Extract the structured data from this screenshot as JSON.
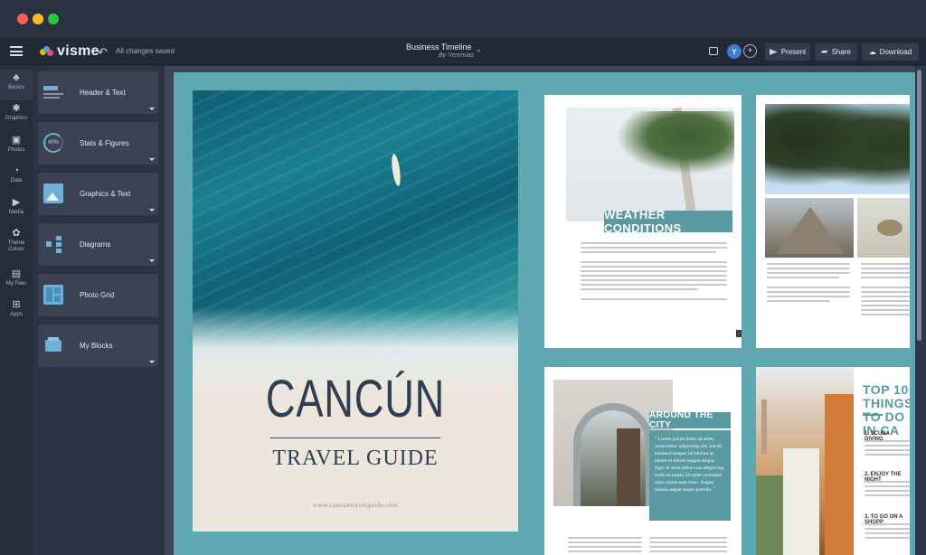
{
  "app": {
    "logo_text": "visme",
    "save_status": "All changes saved",
    "document_title": "Business Timeline",
    "document_author": "By Yeremias",
    "user_initial": "Y",
    "present_label": "Present",
    "share_label": "Share",
    "download_label": "Download"
  },
  "rail": [
    {
      "label": "Basics",
      "icon": "basics-icon"
    },
    {
      "label": "Graphics",
      "icon": "graphics-icon"
    },
    {
      "label": "Photos",
      "icon": "photos-icon"
    },
    {
      "label": "Data",
      "icon": "data-icon"
    },
    {
      "label": "Media",
      "icon": "media-icon"
    },
    {
      "label": "Theme Colors",
      "icon": "palette-icon"
    },
    {
      "label": "My Files",
      "icon": "files-icon"
    },
    {
      "label": "Apps",
      "icon": "apps-icon"
    }
  ],
  "panel": [
    {
      "label": "Header & Text"
    },
    {
      "label": "Stats & Figures",
      "badge": "40%"
    },
    {
      "label": "Graphics & Text"
    },
    {
      "label": "Diagrams"
    },
    {
      "label": "Photo Grid"
    },
    {
      "label": "My Blocks"
    }
  ],
  "cover": {
    "title": "CANCÚN",
    "subtitle": "TRAVEL GUIDE",
    "url": "www.cancuntravelguide.com"
  },
  "pages": {
    "weather_heading": "WEATHER CONDITIONS",
    "city_heading": "AROUND THE CITY",
    "city_quote": "\" Lorem ipsum dolor sit amet, consectetur adipiscing elit, sed do eiusmod tempor incididunt ut labore et dolore magna aliqua. Eget sit amet tellus cras adipiscing enim eu turpis. Ut amet venenatis urna cursus eget nunc. Augue mauris augue neque gravida. \"",
    "top10_heading": "TOP 10 THINGS TO DO IN CA",
    "top10_items": [
      "1. SCUBA DIVING",
      "2. ENJOY THE NIGHT",
      "3. TO GO ON A SHOPP"
    ]
  },
  "colors": {
    "accent": "#5a9aa2",
    "stage": "#5fa8b1",
    "chrome": "#252c3a",
    "avatar": "#3a7bd5"
  }
}
